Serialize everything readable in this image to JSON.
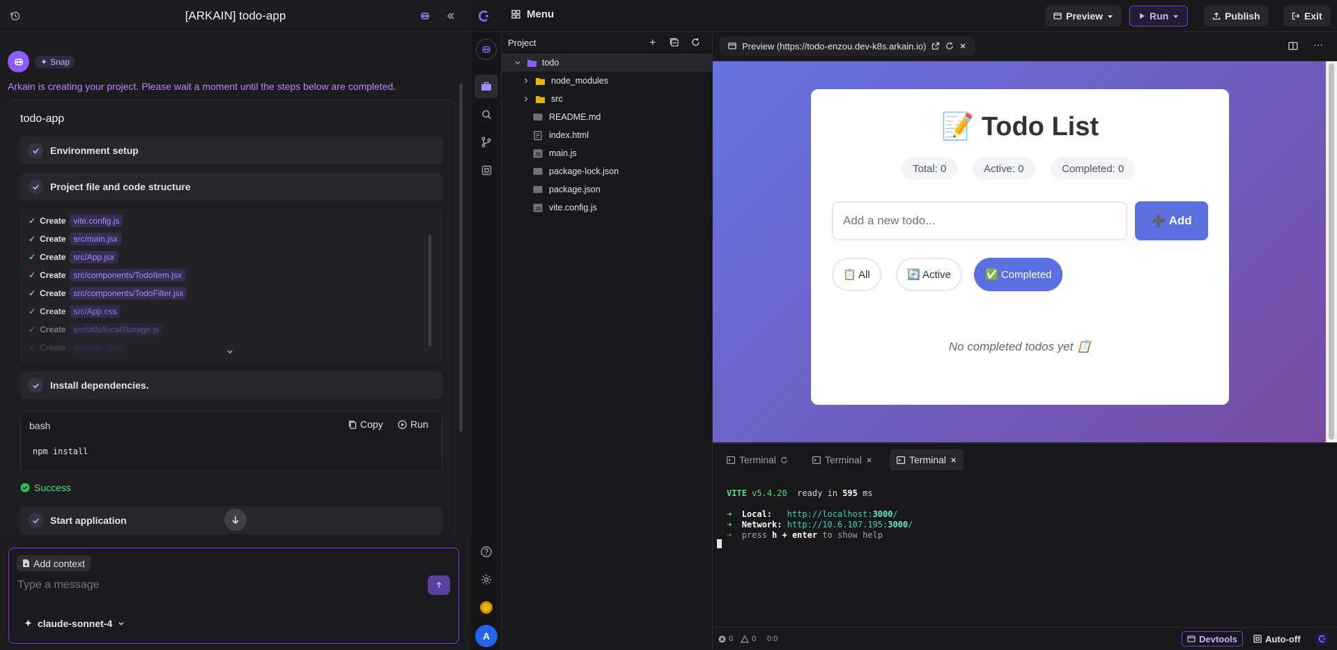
{
  "left": {
    "title": "[ARKAIN] todo-app",
    "snap": "Snap",
    "info": "Arkain is creating your project. Please wait a moment until the steps below are completed.",
    "card_title": "todo-app",
    "steps": [
      "Environment setup",
      "Project file and code structure",
      "Install dependencies.",
      "Start application"
    ],
    "file_rows": [
      {
        "action": "Create",
        "file": "vite.config.js"
      },
      {
        "action": "Create",
        "file": "src/main.jsx"
      },
      {
        "action": "Create",
        "file": "src/App.jsx"
      },
      {
        "action": "Create",
        "file": "src/components/TodoItem.jsx"
      },
      {
        "action": "Create",
        "file": "src/components/TodoFilter.jsx"
      },
      {
        "action": "Create",
        "file": "src/App.css"
      },
      {
        "action": "Create",
        "file": "src/utils/localStorage.js"
      },
      {
        "action": "Create",
        "file": "package.json"
      }
    ],
    "bash": {
      "lang": "bash",
      "copy": "Copy",
      "run": "Run",
      "code": "npm install"
    },
    "success": "Success",
    "input": {
      "context": "Add context",
      "placeholder": "Type a message",
      "model": "claude-sonnet-4"
    }
  },
  "topbar": {
    "menu": "Menu",
    "preview": "Preview",
    "run": "Run",
    "publish": "Publish",
    "exit": "Exit"
  },
  "explorer": {
    "title": "Project",
    "root": "todo",
    "items": [
      {
        "name": "node_modules",
        "kind": "folder"
      },
      {
        "name": "src",
        "kind": "folder"
      },
      {
        "name": "README.md",
        "kind": "file"
      },
      {
        "name": "index.html",
        "kind": "file"
      },
      {
        "name": "main.js",
        "kind": "file"
      },
      {
        "name": "package-lock.json",
        "kind": "file"
      },
      {
        "name": "package.json",
        "kind": "file"
      },
      {
        "name": "vite.config.js",
        "kind": "file"
      }
    ]
  },
  "preview": {
    "tab": "Preview (https://todo-enzou.dev-k8s.arkain.io)",
    "app_title": "📝 Todo List",
    "stats": [
      "Total: 0",
      "Active: 0",
      "Completed: 0"
    ],
    "placeholder": "Add a new todo...",
    "add": "➕ Add",
    "filters": [
      "📋 All",
      "🔄 Active",
      "✅ Completed"
    ],
    "empty": "No completed todos yet 📋"
  },
  "terminal": {
    "tabs": [
      "Terminal",
      "Terminal",
      "Terminal"
    ],
    "vite": "VITE",
    "version": "v5.4.20",
    "ready": "ready in",
    "ms": "595",
    "ms_unit": "ms",
    "local_label": "Local:",
    "local_url_a": "http://localhost:",
    "local_port": "3000",
    "network_label": "Network:",
    "network_url_a": "http://10.6.107.195:",
    "network_port": "3000",
    "slash": "/",
    "help_a": "press",
    "help_b": "h + enter",
    "help_c": "to show help"
  },
  "status": {
    "errors": "0",
    "warnings": "0",
    "pos": "0:0",
    "devtools": "Devtools",
    "auto": "Auto-off"
  },
  "colors": {
    "accent": "#8b5cf6",
    "preview_gradient_start": "#6674e2",
    "preview_gradient_end": "#764ba2",
    "add_button": "#5a6fe0",
    "vite_green": "#4ade80",
    "link_cyan": "#2dd4bf"
  }
}
